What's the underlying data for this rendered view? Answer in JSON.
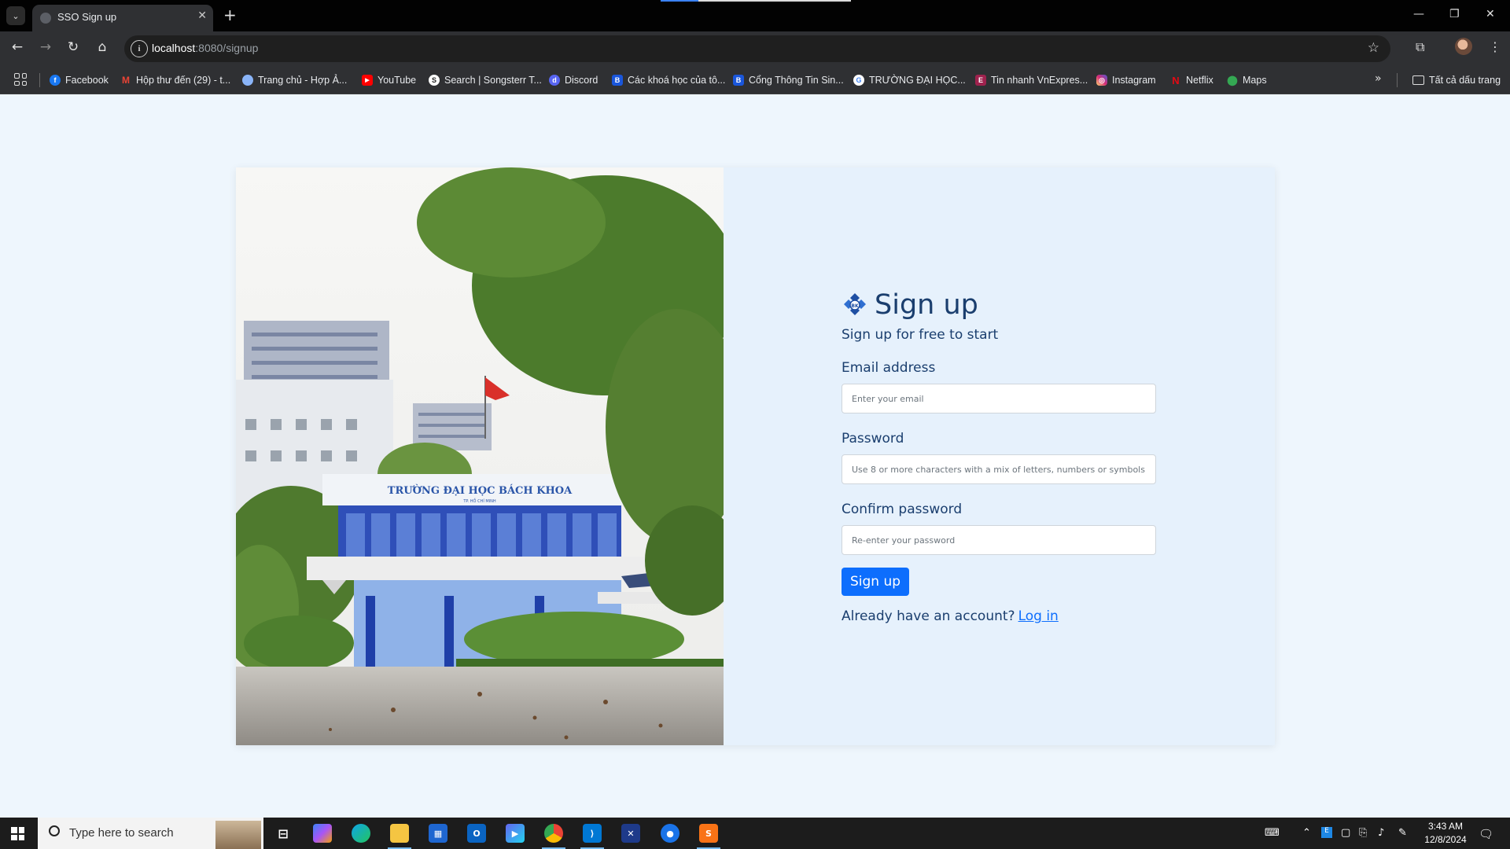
{
  "browser": {
    "tab_title": "SSO Sign up",
    "url_host": "localhost",
    "url_path": ":8080/signup",
    "bookmarks": [
      {
        "label": "Facebook",
        "icon": "facebook-icon",
        "color": "#1877f2"
      },
      {
        "label": "Hộp thư đến (29) - t...",
        "icon": "gmail-icon",
        "color": "#ea4335"
      },
      {
        "label": "Trang chủ - Hợp Ả...",
        "icon": "link-icon",
        "color": "#8ab4f8"
      },
      {
        "label": "YouTube",
        "icon": "youtube-icon",
        "color": "#ff0000"
      },
      {
        "label": "Search | Songsterr T...",
        "icon": "songsterr-icon",
        "color": "#ffffff"
      },
      {
        "label": "Discord",
        "icon": "discord-icon",
        "color": "#5865f2"
      },
      {
        "label": "Các khoá học của tô...",
        "icon": "bk-icon",
        "color": "#1a56db"
      },
      {
        "label": "Cổng Thông Tin Sin...",
        "icon": "bk-icon",
        "color": "#1a56db"
      },
      {
        "label": "TRƯỜNG ĐẠI HỌC...",
        "icon": "google-icon",
        "color": "#ffffff"
      },
      {
        "label": "Tin nhanh VnExpres...",
        "icon": "vnexpress-icon",
        "color": "#9f224e"
      },
      {
        "label": "Instagram",
        "icon": "instagram-icon",
        "color": "#e1306c"
      },
      {
        "label": "Netflix",
        "icon": "netflix-icon",
        "color": "#e50914"
      },
      {
        "label": "Maps",
        "icon": "maps-icon",
        "color": "#34a853"
      }
    ],
    "all_bookmarks_label": "Tất cả dấu trang"
  },
  "signup": {
    "title": "Sign up",
    "subtitle": "Sign up for free to start",
    "email_label": "Email address",
    "email_placeholder": "Enter your email",
    "password_label": "Password",
    "password_placeholder": "Use 8 or more characters with a mix of letters, numbers or symbols",
    "confirm_label": "Confirm password",
    "confirm_placeholder": "Re-enter your password",
    "submit_label": "Sign up",
    "account_prompt": "Already have an account?",
    "login_link": "Log in"
  },
  "photo": {
    "building_sign": "TRƯỜNG ĐẠI HỌC BÁCH KHOA",
    "building_subsign": "TP. HỒ CHÍ MINH"
  },
  "taskbar": {
    "search_placeholder": "Type here to search",
    "time": "3:43 AM",
    "date": "12/8/2024"
  },
  "colors": {
    "accent": "#0d6efd",
    "heading": "#1a3e6e",
    "page_bg": "#eef6fd",
    "card_bg": "#e6f1fc"
  }
}
